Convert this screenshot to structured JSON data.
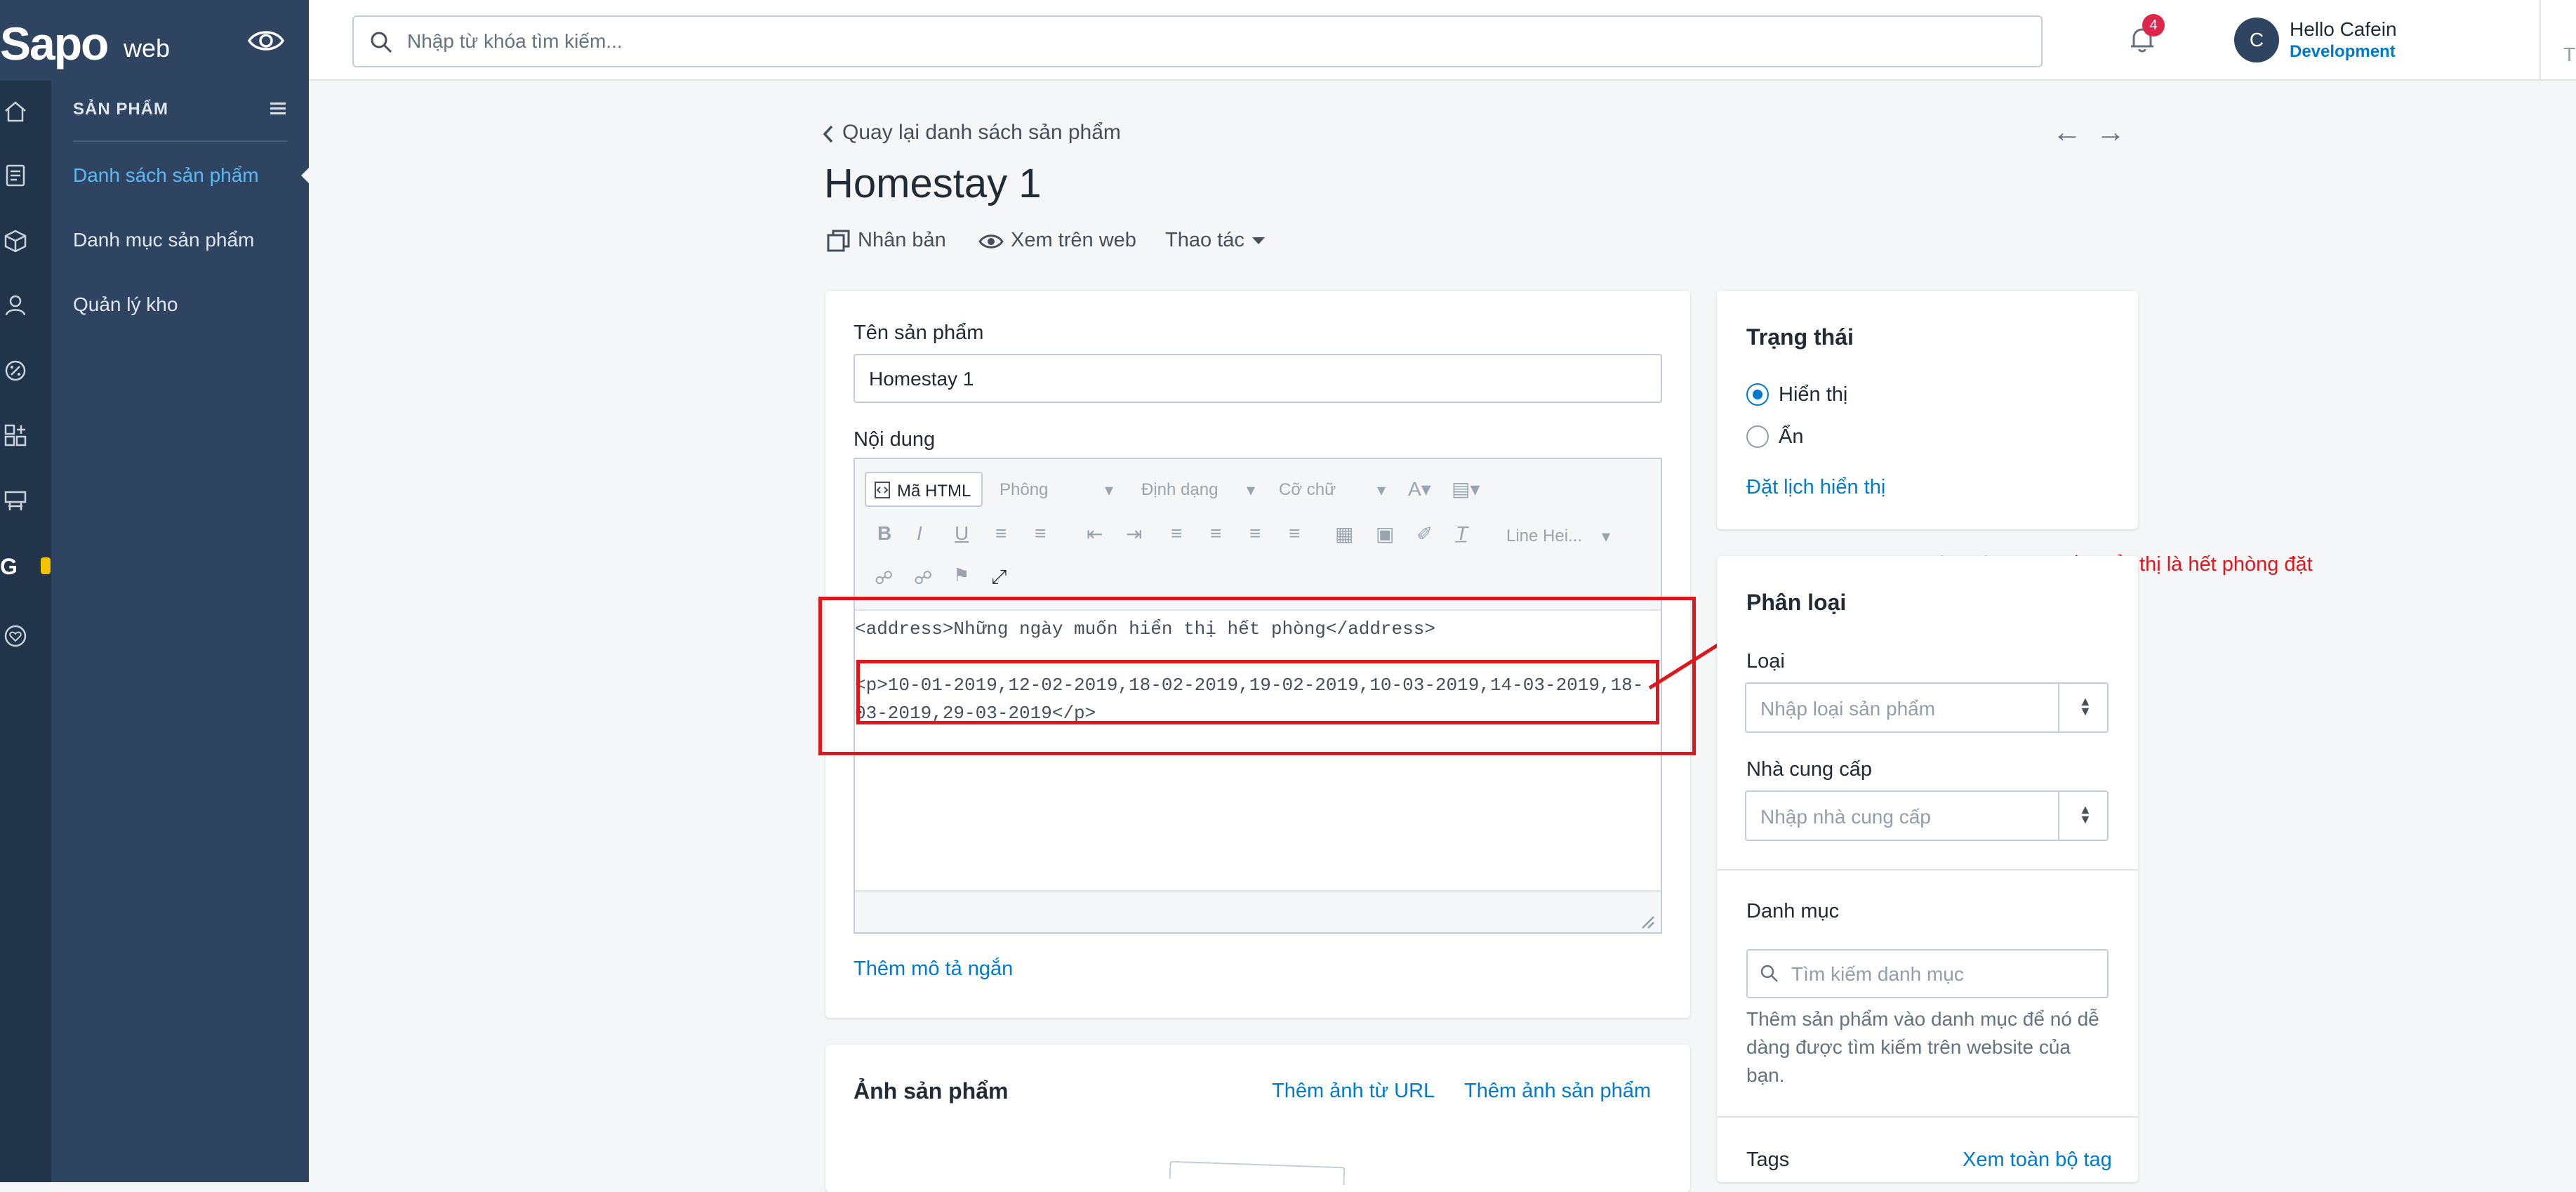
{
  "brand": {
    "logo_main": "Sapo",
    "logo_sub": "web"
  },
  "topbar": {
    "search_placeholder": "Nhập từ khóa tìm kiếm...",
    "notification_count": "4",
    "user_initial": "C",
    "user_name": "Hello Cafein",
    "user_role": "Development",
    "edge_text": "T"
  },
  "sidebar": {
    "section_title": "SẢN PHẨM",
    "items": [
      {
        "label": "Danh sách sản phẩm",
        "active": true
      },
      {
        "label": "Danh mục sản phẩm",
        "active": false
      },
      {
        "label": "Quản lý kho",
        "active": false
      }
    ]
  },
  "header": {
    "back_link": "Quay lại danh sách sản phẩm",
    "title": "Homestay 1",
    "actions": {
      "duplicate": "Nhân bản",
      "view_web": "Xem trên web",
      "more": "Thao tác"
    }
  },
  "product": {
    "name_label": "Tên sản phẩm",
    "name_value": "Homestay 1",
    "content_label": "Nội dung",
    "editor": {
      "html_button": "Mã HTML",
      "font_select": "Phông",
      "format_select": "Định dạng",
      "size_select": "Cỡ chữ",
      "line_height_select": "Line Hei...",
      "code_line1": "<address>Những ngày muốn hiển thị hết phòng</address>",
      "code_line2": "<p>10-01-2019,12-02-2019,18-02-2019,19-02-2019,10-03-2019,14-03-2019,18-",
      "code_line3": "03-2019,29-03-2019</p>"
    },
    "short_desc_link": "Thêm mô tả ngắn"
  },
  "images_card": {
    "title": "Ảnh sản phẩm",
    "add_url": "Thêm ảnh từ URL",
    "add_image": "Thêm ảnh sản phẩm"
  },
  "annotation": "Những ngày mà bạn muốn hiển thị là hết phòng đặt",
  "status_card": {
    "title": "Trạng thái",
    "option_show": "Hiển thị",
    "option_hide": "Ẩn",
    "selected": "Hiển thị",
    "schedule_link": "Đặt lịch hiển thị"
  },
  "classify_card": {
    "title": "Phân loại",
    "type_label": "Loại",
    "type_placeholder": "Nhập loại sản phẩm",
    "vendor_label": "Nhà cung cấp",
    "vendor_placeholder": "Nhập nhà cung cấp",
    "category_label": "Danh mục",
    "category_placeholder": "Tìm kiếm danh mục",
    "category_help": [
      "Thêm sản phẩm vào danh mục để nó dễ",
      "dàng được tìm kiếm trên website của",
      "bạn."
    ],
    "tags_label": "Tags",
    "tags_link": "Xem toàn bộ tag"
  },
  "colors": {
    "accent": "#007ace",
    "annotation": "#e0161d",
    "sidebar": "#2e4460",
    "rail": "#21344a"
  }
}
